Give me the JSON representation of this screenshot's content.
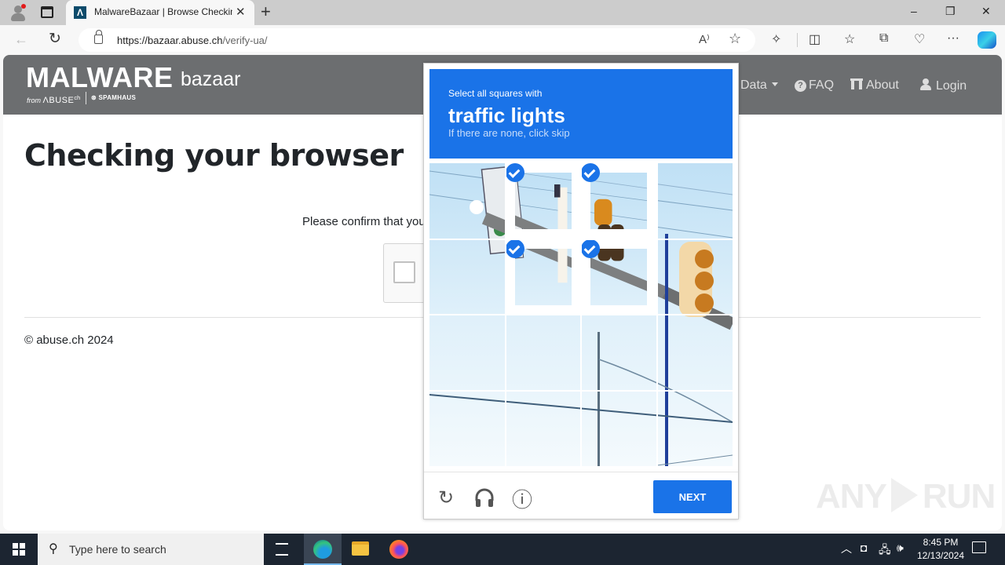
{
  "browser": {
    "tab_title": "MalwareBazaar | Browse Checking your browser",
    "tab_favicon": "Λ",
    "url_host": "https://bazaar.abuse.ch",
    "url_path": "/verify-ua/",
    "icons": {
      "profile": "profile-icon",
      "tab_actions": "tab-actions-icon",
      "new_tab": "+",
      "back": "←",
      "reload": "↻",
      "read_aloud": "A⁾",
      "favorite": "☆",
      "extensions": "extensions-icon",
      "split_screen": "split-screen-icon",
      "favorites": "favorites-icon",
      "collections": "collections-icon",
      "browser_essentials": "browser-essentials-icon",
      "more": "···",
      "copilot": "copilot-icon"
    },
    "window_controls": {
      "minimize": "–",
      "restore": "❐",
      "close": "✕"
    }
  },
  "site": {
    "logo": {
      "main": "MALWARE",
      "sub": "bazaar",
      "from": "from",
      "abuse": "ΛBUSE",
      "abuse_sup": "ch",
      "spamhaus": "SPAMHAUS"
    },
    "nav": [
      {
        "label": "Data",
        "has_caret": true
      },
      {
        "label": "FAQ",
        "icon": "?"
      },
      {
        "label": "About"
      },
      {
        "label": "Login"
      }
    ],
    "page_title": "Checking your browser",
    "confirm_text": "Please confirm that you are not a robot",
    "footer": "© abuse.ch 2024",
    "watermark": {
      "left": "ANY",
      "right": "RUN"
    }
  },
  "captcha": {
    "instruction": "Select all squares with",
    "object": "traffic lights",
    "hint": "If there are none, click skip",
    "grid_size": 4,
    "selected_tiles": [
      1,
      2,
      5,
      6
    ],
    "tiles": [
      {
        "selected": false
      },
      {
        "selected": true
      },
      {
        "selected": true
      },
      {
        "selected": false
      },
      {
        "selected": false
      },
      {
        "selected": true
      },
      {
        "selected": true
      },
      {
        "selected": false
      },
      {
        "selected": false
      },
      {
        "selected": false
      },
      {
        "selected": false
      },
      {
        "selected": false
      },
      {
        "selected": false
      },
      {
        "selected": false
      },
      {
        "selected": false
      },
      {
        "selected": false
      }
    ],
    "footer": {
      "reload_icon": "↻",
      "audio_icon": "🎧",
      "info_icon": "ⓘ",
      "next_label": "NEXT"
    },
    "accent": "#1a73e8"
  },
  "taskbar": {
    "search_placeholder": "Type here to search",
    "search_icon": "⚲",
    "apps": [
      "task-view",
      "edge",
      "file-explorer",
      "firefox"
    ],
    "tray": {
      "chevron": "^",
      "meet": "meet-now-icon",
      "network": "network-icon",
      "volume": "🕪"
    },
    "time": "8:45 PM",
    "date": "12/13/2024"
  }
}
